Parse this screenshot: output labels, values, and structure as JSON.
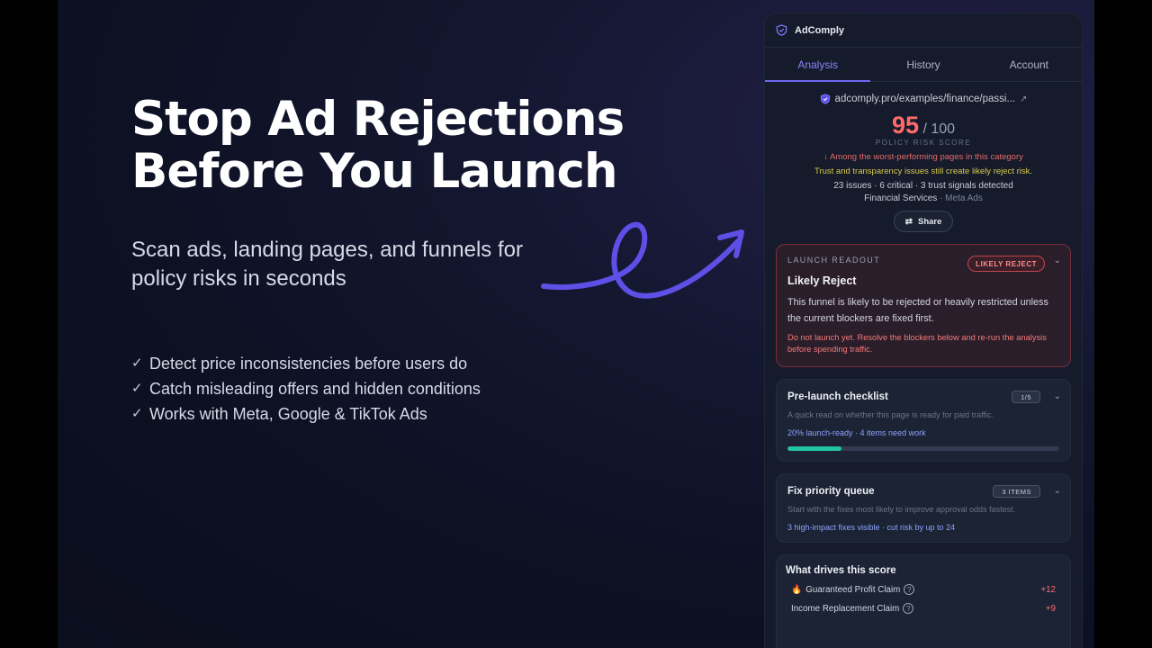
{
  "hero": {
    "title_line1": "Stop Ad Rejections",
    "title_line2": "Before You Launch",
    "subtitle": "Scan ads, landing pages, and funnels for policy risks in seconds",
    "features": [
      "Detect price inconsistencies before users do",
      "Catch misleading offers and hidden conditions",
      "Works with Meta, Google & TikTok Ads"
    ],
    "accent_color": "#5b4fe0"
  },
  "panel": {
    "brand": "AdComply",
    "tabs": [
      "Analysis",
      "History",
      "Account"
    ],
    "active_tab": "Analysis",
    "url": "adcomply.pro/examples/finance/passi...",
    "score": "95",
    "score_max": "/ 100",
    "score_label": "POLICY RISK SCORE",
    "worst_note": "↓ Among the worst-performing pages in this category",
    "trust_note": "Trust and transparency issues still create likely reject risk.",
    "issues_summary": "23 issues · 6 critical · 3 trust signals detected",
    "category": "Financial Services",
    "platform": "· Meta Ads",
    "share_label": "Share",
    "launch": {
      "kicker": "LAUNCH READOUT",
      "badge": "LIKELY REJECT",
      "title": "Likely Reject",
      "body": "This funnel is likely to be rejected or heavily restricted unless the current blockers are fixed first.",
      "warning": "Do not launch yet. Resolve the blockers below and re-run the analysis before spending traffic."
    },
    "checklist": {
      "title": "Pre-launch checklist",
      "pill": "1/5",
      "desc": "A quick read on whether this page is ready for paid traffic.",
      "meta": "20% launch-ready · 4 items need work",
      "progress": 0.2
    },
    "queue": {
      "title": "Fix priority queue",
      "pill": "3 ITEMS",
      "desc": "Start with the fixes most likely to improve approval odds fastest.",
      "meta": "3 high-impact fixes visible · cut risk by up to 24"
    },
    "drivers": {
      "title": "What drives this score",
      "items": [
        {
          "icon": "🔥",
          "name": "Guaranteed Profit Claim",
          "value": "+12"
        },
        {
          "icon": "",
          "name": "Income Replacement Claim",
          "value": "+9"
        }
      ]
    }
  }
}
